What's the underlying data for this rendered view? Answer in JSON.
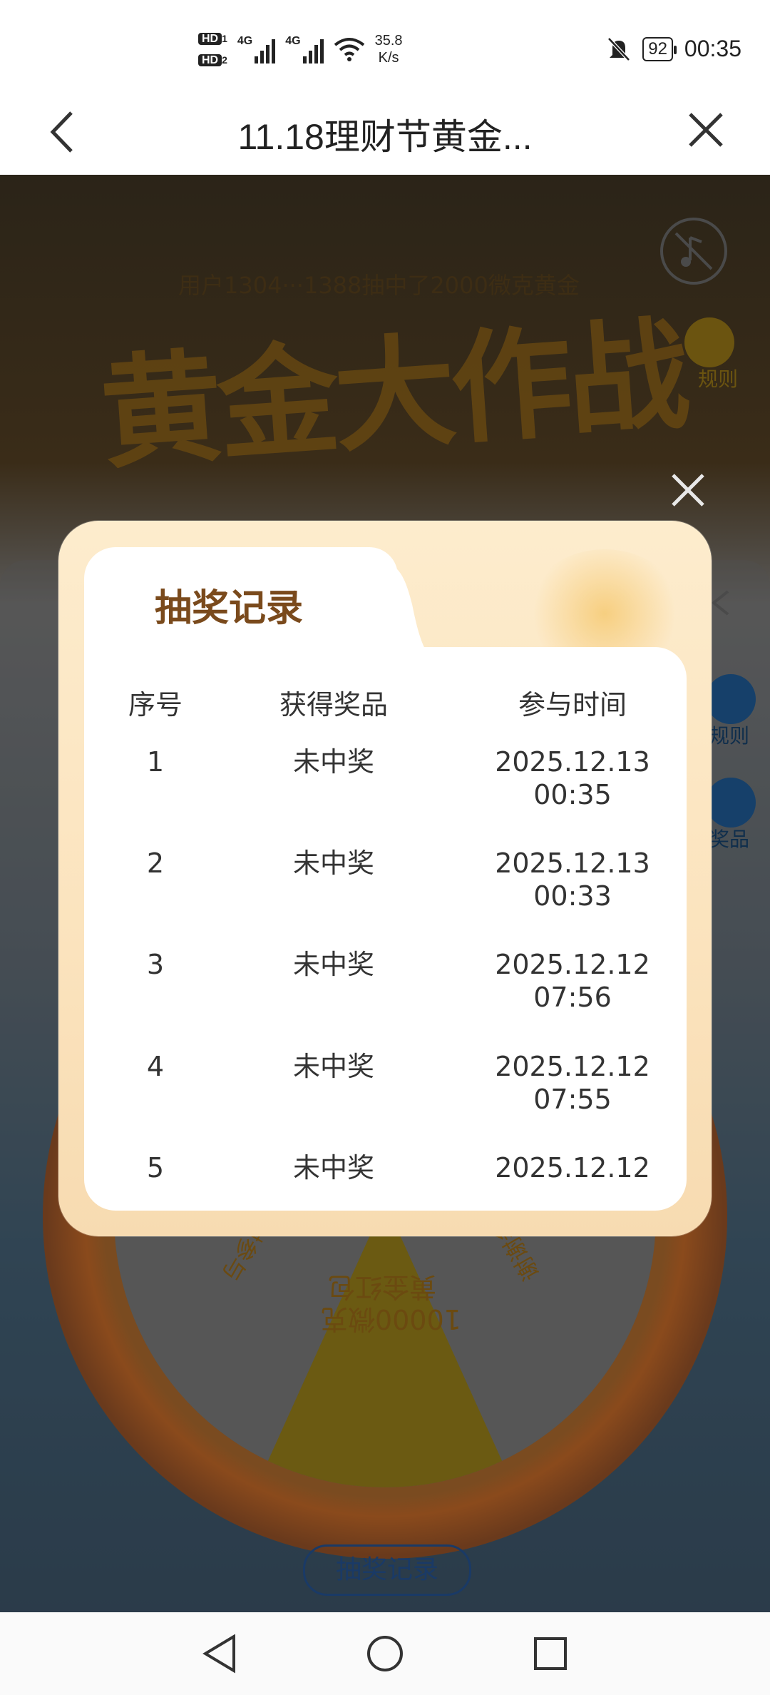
{
  "status_bar": {
    "hd1": "HD",
    "hd2": "HD",
    "sim1": "1",
    "sim2": "2",
    "net1": "4G",
    "net2": "4G",
    "speed_value": "35.8",
    "speed_unit": "K/s",
    "battery": "92",
    "time": "00:35"
  },
  "navbar": {
    "title": "11.18理财节黄金..."
  },
  "background": {
    "subtitle": "用户1304···1388抽中了2000微克黄金",
    "hero_title": "黄金大作战",
    "rules_label": "规则",
    "side_rules_label": "规则",
    "side_prize_label": "奖品",
    "wheel_center_text_line1": "10000微克",
    "wheel_center_text_line2": "黄金红包",
    "wheel_left_text": "谢谢参与",
    "wheel_right_text": "谢谢参与",
    "history_button": "抽奖记录"
  },
  "modal": {
    "title": "抽奖记录",
    "headers": [
      "序号",
      "获得奖品",
      "参与时间"
    ],
    "rows": [
      {
        "index": "1",
        "prize": "未中奖",
        "date": "2025.12.13",
        "time": "00:35"
      },
      {
        "index": "2",
        "prize": "未中奖",
        "date": "2025.12.13",
        "time": "00:33"
      },
      {
        "index": "3",
        "prize": "未中奖",
        "date": "2025.12.12",
        "time": "07:56"
      },
      {
        "index": "4",
        "prize": "未中奖",
        "date": "2025.12.12",
        "time": "07:55"
      },
      {
        "index": "5",
        "prize": "未中奖",
        "date": "2025.12.12",
        "time": ""
      }
    ]
  },
  "icons": {
    "back": "chevron-left-icon",
    "close": "close-icon",
    "mute": "music-off-icon",
    "nav_back": "triangle-back-icon",
    "nav_home": "circle-home-icon",
    "nav_recent": "square-recent-icon"
  },
  "colors": {
    "modal_title": "#7a4a1c",
    "modal_bg": "#fbe3bd",
    "history_button": "#1a3a66"
  }
}
